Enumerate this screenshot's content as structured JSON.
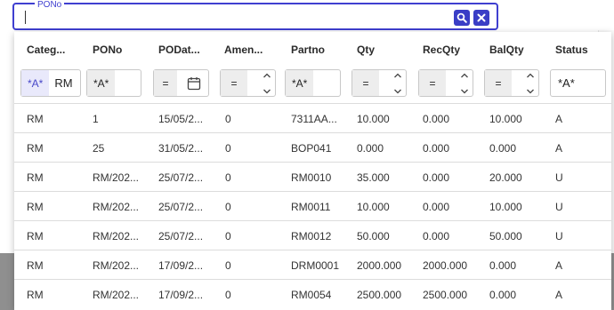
{
  "search": {
    "legend": "PONo",
    "value": ""
  },
  "grid": {
    "columns": [
      {
        "key": "category",
        "label": "Categ..."
      },
      {
        "key": "pono",
        "label": "PONo"
      },
      {
        "key": "podate",
        "label": "PODat..."
      },
      {
        "key": "amend",
        "label": "Amen..."
      },
      {
        "key": "partno",
        "label": "Partno"
      },
      {
        "key": "qty",
        "label": "Qty"
      },
      {
        "key": "recqty",
        "label": "RecQty"
      },
      {
        "key": "balqty",
        "label": "BalQty"
      },
      {
        "key": "status",
        "label": "Status"
      }
    ],
    "filters": {
      "category": {
        "mode": "*A*",
        "value": "RM"
      },
      "pono": {
        "mode": "*A*",
        "value": ""
      },
      "podate": {
        "op": "=",
        "value": ""
      },
      "amend": {
        "op": "=",
        "value": ""
      },
      "partno": {
        "mode": "*A*",
        "value": ""
      },
      "qty": {
        "op": "=",
        "value": ""
      },
      "recqty": {
        "op": "=",
        "value": ""
      },
      "balqty": {
        "op": "=",
        "value": ""
      },
      "status": {
        "mode": "*A*",
        "value": ""
      }
    },
    "rows": [
      [
        "RM",
        "1",
        "15/05/2...",
        "0",
        "7311AA...",
        "10.000",
        "0.000",
        "10.000",
        "A"
      ],
      [
        "RM",
        "25",
        "31/05/2...",
        "0",
        "BOP041",
        "0.000",
        "0.000",
        "0.000",
        "A"
      ],
      [
        "RM",
        "RM/202...",
        "25/07/2...",
        "0",
        "RM0010",
        "35.000",
        "0.000",
        "20.000",
        "U"
      ],
      [
        "RM",
        "RM/202...",
        "25/07/2...",
        "0",
        "RM0011",
        "10.000",
        "0.000",
        "10.000",
        "U"
      ],
      [
        "RM",
        "RM/202...",
        "25/07/2...",
        "0",
        "RM0012",
        "50.000",
        "0.000",
        "50.000",
        "U"
      ],
      [
        "RM",
        "RM/202...",
        "17/09/2...",
        "0",
        "DRM0001",
        "2000.000",
        "2000.000",
        "0.000",
        "A"
      ],
      [
        "RM",
        "RM/202...",
        "17/09/2...",
        "0",
        "RM0054",
        "2500.000",
        "2500.000",
        "0.000",
        "A"
      ]
    ]
  },
  "icons": {
    "search_button": "search-icon",
    "clear_button": "close-icon",
    "date_picker": "calendar-icon",
    "spin_up": "chevron-up-icon",
    "spin_down": "chevron-down-icon"
  },
  "colors": {
    "accent": "#3f3fd0",
    "button": "#3a3ec6",
    "chip_bg": "#e9e9fb",
    "operator_bg": "#ededed"
  }
}
